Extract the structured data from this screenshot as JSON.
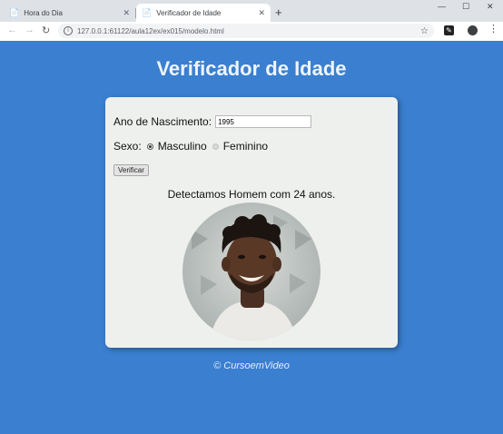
{
  "browser": {
    "tabs": [
      {
        "label": "Hora do Dia",
        "active": false
      },
      {
        "label": "Verificador de Idade",
        "active": true
      }
    ],
    "new_tab_label": "+",
    "url": "127.0.0.1:61122/aula12ex/ex015/modelo.html"
  },
  "page": {
    "title": "Verificador de Idade",
    "form": {
      "year_label": "Ano de Nascimento:",
      "year_value": "1995",
      "sex_label": "Sexo:",
      "options": [
        {
          "label": "Masculino",
          "checked": true
        },
        {
          "label": "Feminino",
          "checked": false
        }
      ],
      "submit_label": "Verificar"
    },
    "result_text": "Detectamos Homem com 24 anos.",
    "footer": "© CursoemVideo"
  },
  "colors": {
    "page_background": "#3a7fd0",
    "card_background": "#eef0ee"
  }
}
